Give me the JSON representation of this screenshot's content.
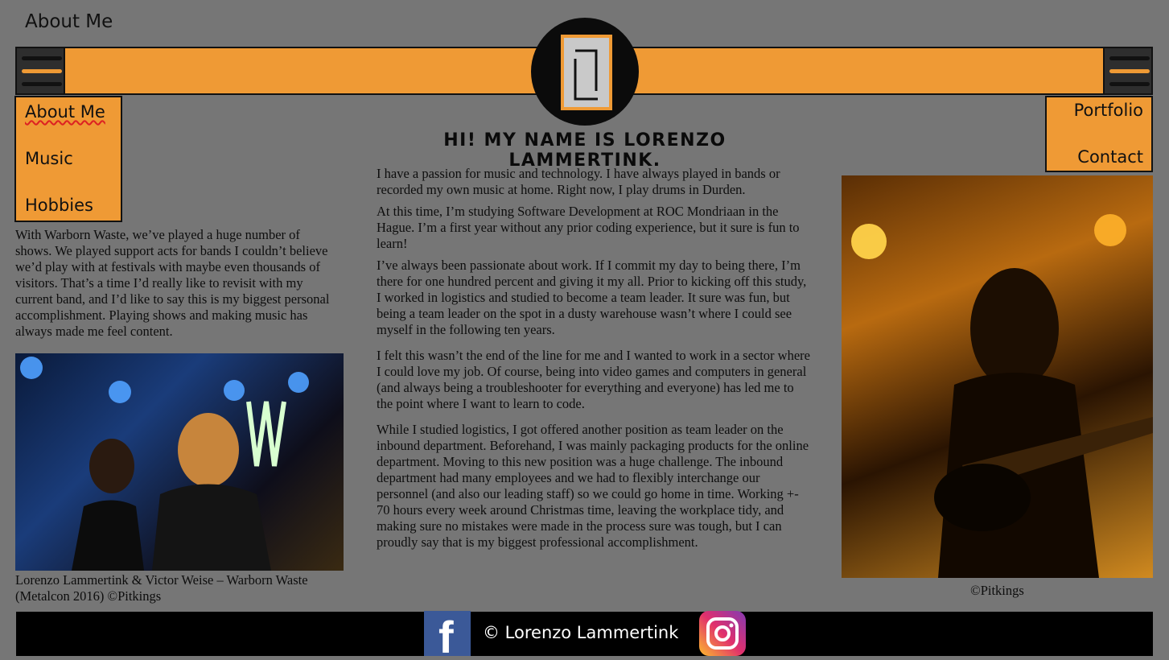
{
  "page": {
    "title": "About Me"
  },
  "nav": {
    "left_items": [
      "About Me",
      "Music",
      "Hobbies"
    ],
    "right_items": [
      "Portfolio",
      "Contact"
    ]
  },
  "main": {
    "heading": "Hi! My name is Lorenzo Lammertink.",
    "paragraphs": [
      "I have a passion for music and technology. I have always played in bands or recorded my own music at home. Right now, I play drums in Durden.",
      "At this time, I’m studying Software Development at ROC Mondriaan in the Hague. I’m a first year without any prior coding experience, but it sure is fun to learn!",
      "I’ve always been passionate about work. If I commit my day to being there, I’m there for one hundred percent and giving it my all. Prior to kicking off this study, I worked in logistics and studied to become a team leader. It sure was fun, but being a team leader on the spot in a dusty warehouse wasn’t where I could see myself in the following ten years.",
      "I felt this wasn’t the end of the line for me and I wanted to work in a sector where I could love my job. Of course, being into video games and computers in general (and always being a troubleshooter for everything and everyone) has led me to the point where I want to learn to code.",
      "While I studied logistics, I got offered another position as team leader on the inbound department. Beforehand, I was mainly packaging products for the online department. Moving to this new position was a huge challenge. The inbound department had many employees and we had to flexibly interchange our personnel (and also our leading staff) so we could go home in time. Working +- 70 hours every week around Christmas time, leaving the workplace tidy, and making sure no mistakes were made in the process sure was tough, but I can proudly say that is my biggest professional accomplishment."
    ]
  },
  "left": {
    "paragraph": "With Warborn Waste, we’ve played a huge number of shows. We played support acts for bands I couldn’t believe we’d play with at festivals with maybe even thousands of visitors. That’s a time I’d really like to revisit with my current band, and I’d like to say this is my biggest personal accomplishment. Playing shows and making music has always made me feel content.",
    "caption": "Lorenzo Lammertink & Victor Weise – Warborn Waste (Metalcon 2016) ©Pitkings"
  },
  "right": {
    "caption": "©Pitkings"
  },
  "footer": {
    "copyright": "© Lorenzo Lammertink",
    "facebook_glyph": "f"
  },
  "colors": {
    "accent": "#ef9a35",
    "background": "#767676",
    "dark": "#111111",
    "footer": "#000000"
  },
  "icons": [
    "menu-icon",
    "logo-icon",
    "facebook-icon",
    "instagram-icon"
  ]
}
